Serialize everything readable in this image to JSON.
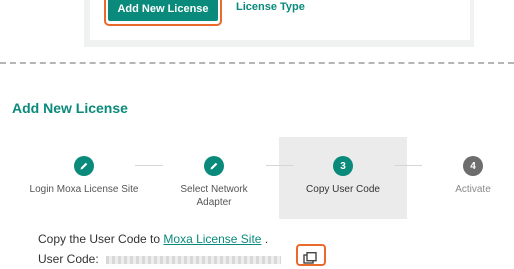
{
  "top_panel": {
    "add_button_label": "Add New License",
    "license_type_label": "License Type"
  },
  "section": {
    "title": "Add New License"
  },
  "stepper": {
    "steps": [
      {
        "icon": "pencil-icon",
        "number": "",
        "label": "Login Moxa License Site",
        "state": "done"
      },
      {
        "icon": "pencil-icon",
        "number": "",
        "label": "Select Network Adapter",
        "state": "done"
      },
      {
        "icon": "",
        "number": "3",
        "label": "Copy User Code",
        "state": "current"
      },
      {
        "icon": "",
        "number": "4",
        "label": "Activate",
        "state": "pending"
      }
    ]
  },
  "instruction": {
    "prefix": "Copy the User Code to",
    "link": "Moxa License Site",
    "suffix": ".",
    "user_code_label": "User Code:"
  },
  "colors": {
    "accent": "#0a8a7a",
    "highlight": "#ea6a2c",
    "pending": "#6d6d6d"
  }
}
